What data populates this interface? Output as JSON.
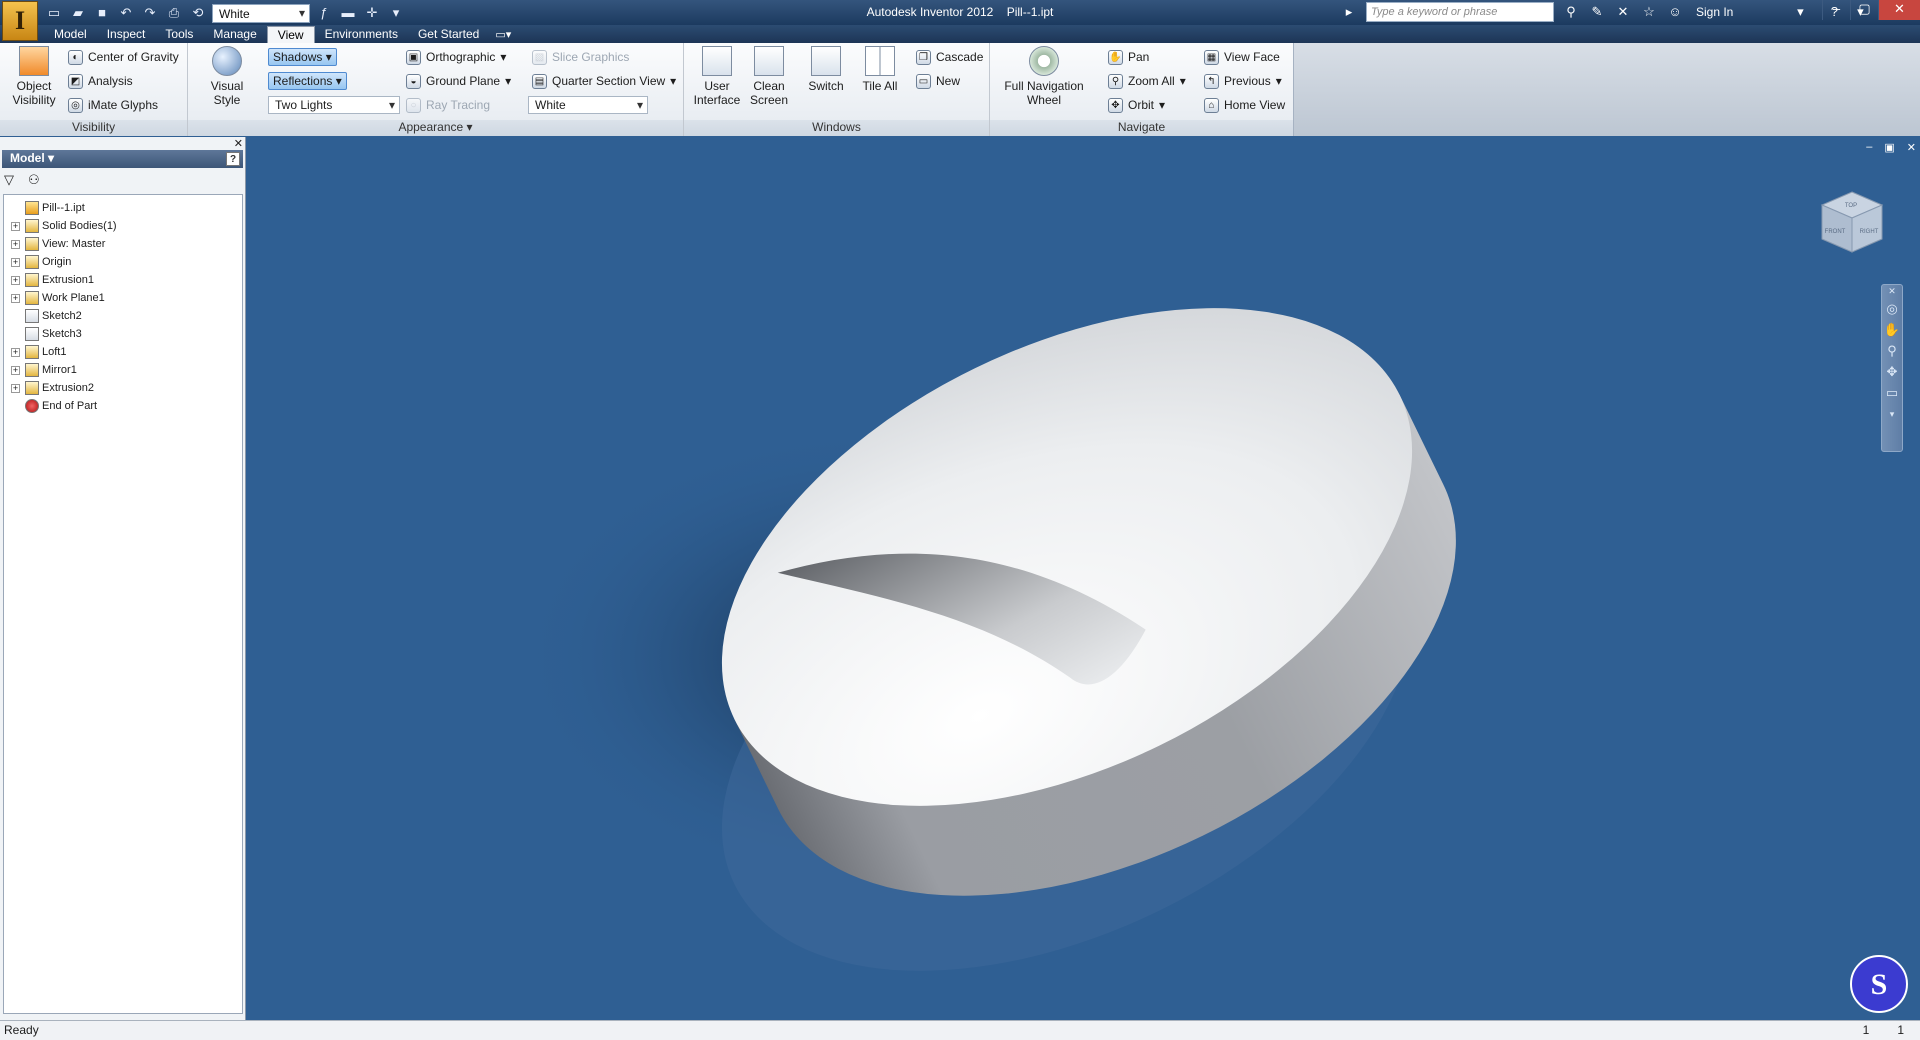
{
  "app": {
    "title": "Autodesk Inventor 2012",
    "document": "Pill--1.ipt",
    "logo_letter": "I"
  },
  "qat": {
    "appearance_value": "White",
    "icons": [
      "new-icon",
      "open-icon",
      "save-icon",
      "undo-icon",
      "redo-icon",
      "print-icon",
      "return-icon",
      "function-icon",
      "color-icon"
    ]
  },
  "search": {
    "placeholder": "Type a keyword or phrase",
    "signin": "Sign In"
  },
  "menu": {
    "tabs": [
      "Model",
      "Inspect",
      "Tools",
      "Manage",
      "View",
      "Environments",
      "Get Started"
    ],
    "active": "View"
  },
  "ribbon": {
    "visibility": {
      "title": "Visibility",
      "object_visibility": "Object Visibility",
      "center_of_gravity": "Center of Gravity",
      "analysis": "Analysis",
      "imate_glyphs": "iMate Glyphs"
    },
    "appearance": {
      "title": "Appearance",
      "visual_style": "Visual Style",
      "shadows": "Shadows",
      "reflections": "Reflections",
      "lighting": "Two Lights",
      "orthographic": "Orthographic",
      "ground_plane": "Ground Plane",
      "ray_tracing": "Ray Tracing",
      "slice_graphics": "Slice Graphics",
      "quarter_section_view": "Quarter Section View",
      "color": "White"
    },
    "windows": {
      "title": "Windows",
      "user_interface": "User Interface",
      "clean_screen": "Clean Screen",
      "switch": "Switch",
      "tile_all": "Tile All",
      "cascade": "Cascade",
      "new": "New"
    },
    "navigate": {
      "title": "Navigate",
      "full_nav_wheel": "Full Navigation Wheel",
      "pan": "Pan",
      "zoom_all": "Zoom All",
      "orbit": "Orbit",
      "view_face": "View Face",
      "previous": "Previous",
      "home_view": "Home View"
    }
  },
  "browser": {
    "title": "Model",
    "tree": [
      {
        "label": "Pill--1.ipt",
        "icon": "part",
        "expand": false,
        "root": true
      },
      {
        "label": "Solid Bodies(1)",
        "icon": "solid",
        "expand": true
      },
      {
        "label": "View: Master",
        "icon": "view",
        "expand": true
      },
      {
        "label": "Origin",
        "icon": "folder",
        "expand": true
      },
      {
        "label": "Extrusion1",
        "icon": "extrude",
        "expand": true
      },
      {
        "label": "Work Plane1",
        "icon": "workplane",
        "expand": true
      },
      {
        "label": "Sketch2",
        "icon": "sketch",
        "expand": false
      },
      {
        "label": "Sketch3",
        "icon": "sketch",
        "expand": false
      },
      {
        "label": "Loft1",
        "icon": "loft",
        "expand": true
      },
      {
        "label": "Mirror1",
        "icon": "mirror",
        "expand": true
      },
      {
        "label": "Extrusion2",
        "icon": "extrude",
        "expand": true
      },
      {
        "label": "End of Part",
        "icon": "end",
        "expand": false
      }
    ]
  },
  "viewcube": {
    "faces": [
      "TOP",
      "FRONT",
      "RIGHT"
    ]
  },
  "status": {
    "text": "Ready",
    "count1": "1",
    "count2": "1"
  }
}
